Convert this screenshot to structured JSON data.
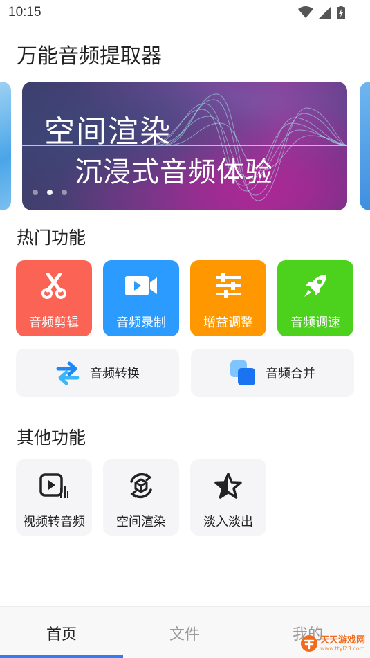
{
  "status_bar": {
    "time": "10:15",
    "icons": [
      "wifi-icon",
      "signal-icon",
      "battery-charging-icon"
    ]
  },
  "page": {
    "title": "万能音频提取器"
  },
  "banner": {
    "title": "空间渲染",
    "subtitle": "沉浸式音频体验",
    "dots": 3,
    "active_dot": 1
  },
  "hot_section": {
    "title": "热门功能",
    "tiles": [
      {
        "label": "音频剪辑",
        "icon": "scissors-icon",
        "color": "#fb6455"
      },
      {
        "label": "音频录制",
        "icon": "video-record-icon",
        "color": "#2b9bff"
      },
      {
        "label": "增益调整",
        "icon": "sliders-icon",
        "color": "#ff9800"
      },
      {
        "label": "音频调速",
        "icon": "rocket-icon",
        "color": "#4cd11c"
      }
    ],
    "wide_tiles": [
      {
        "label": "音频转换",
        "icon": "convert-arrows-icon"
      },
      {
        "label": "音频合并",
        "icon": "merge-squares-icon"
      }
    ]
  },
  "other_section": {
    "title": "其他功能",
    "tiles": [
      {
        "label": "视频转音频",
        "icon": "video-to-audio-icon"
      },
      {
        "label": "空间渲染",
        "icon": "spatial-cube-icon"
      },
      {
        "label": "淡入淡出",
        "icon": "star-fade-icon"
      }
    ]
  },
  "bottom_nav": {
    "tabs": [
      "首页",
      "文件",
      "我的"
    ],
    "active_index": 0,
    "accent": "#2f7cf6"
  },
  "watermark": {
    "main": "天天游戏网",
    "url": "www.ttyl23.com"
  }
}
